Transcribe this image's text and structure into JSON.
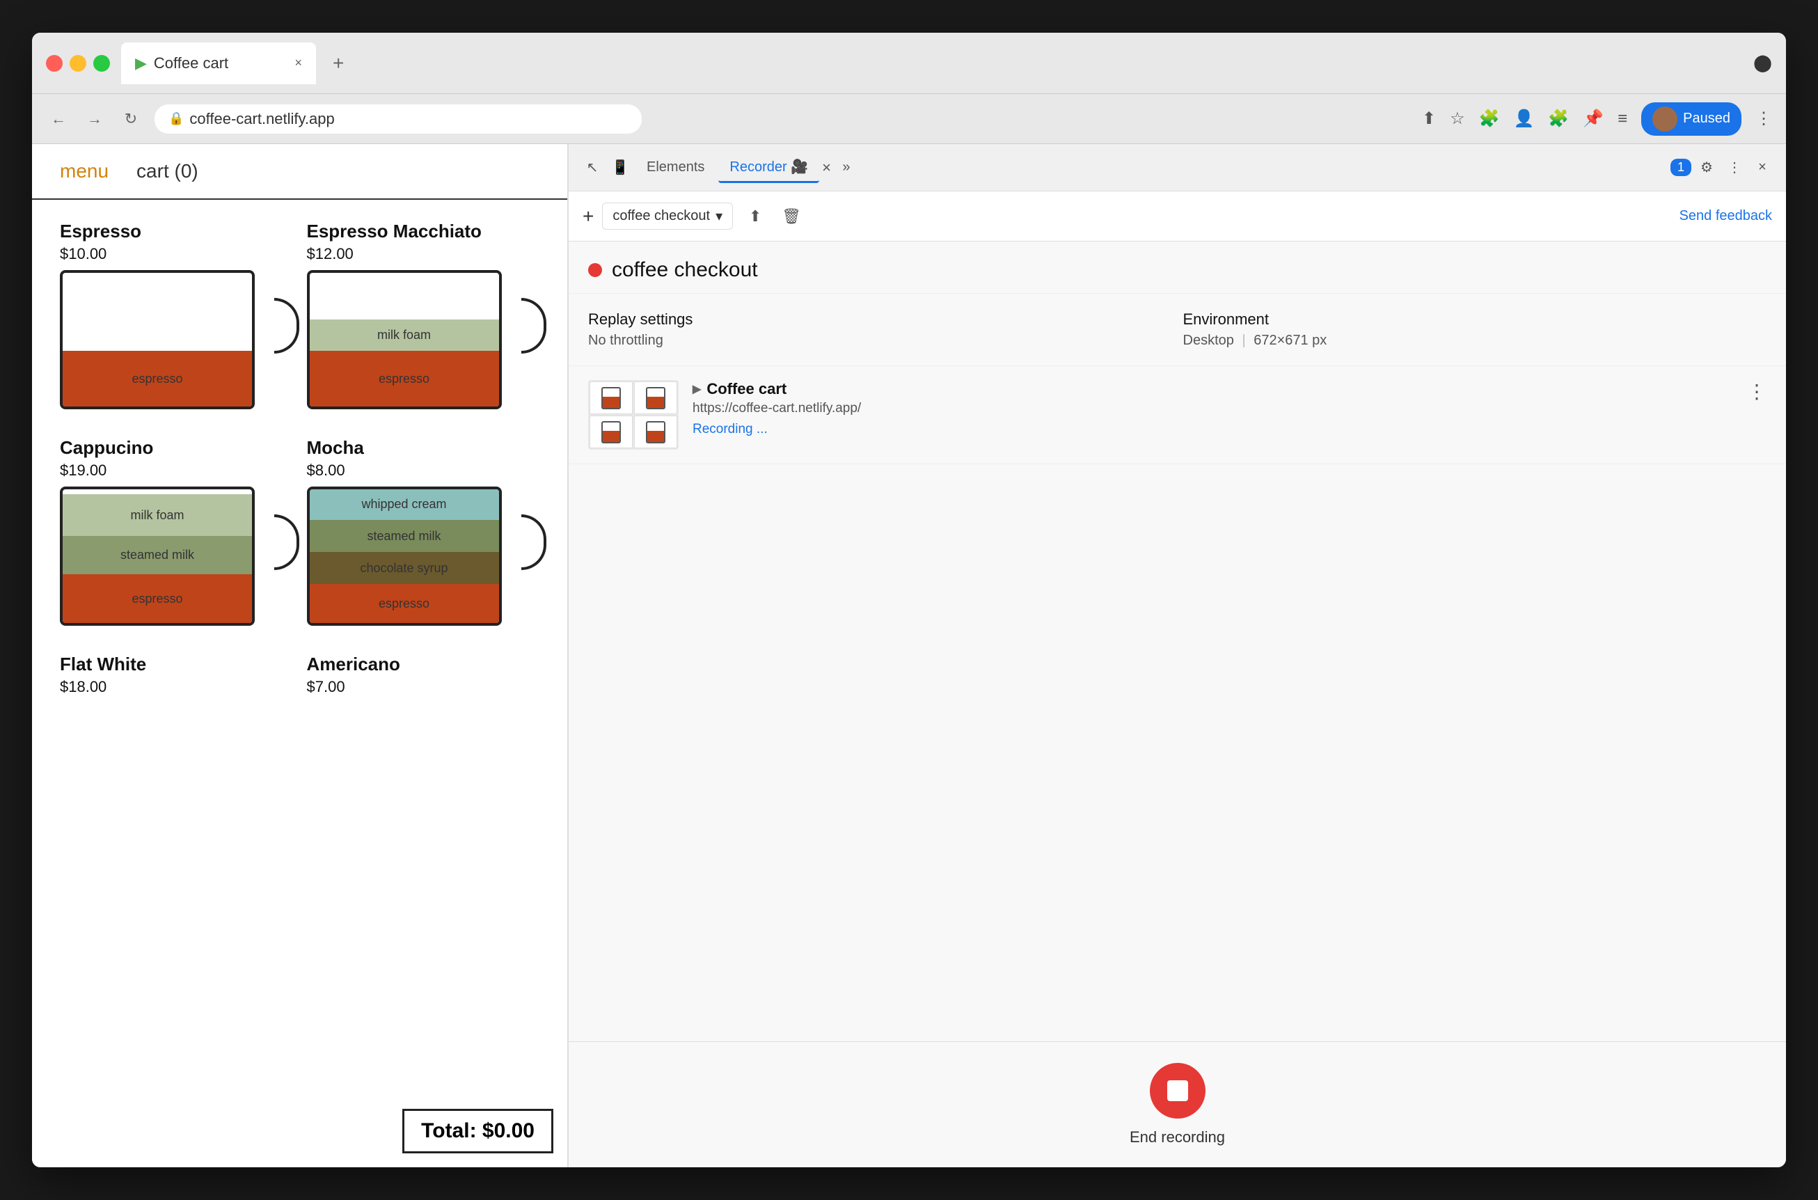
{
  "browser": {
    "tab_title": "Coffee cart",
    "tab_favicon": "▶",
    "new_tab_icon": "+",
    "address": "coffee-cart.netlify.app",
    "nav_back": "←",
    "nav_forward": "→",
    "nav_reload": "↻",
    "paused_label": "Paused",
    "devtools_circle_icon": "⬤"
  },
  "devtools": {
    "add_icon": "+",
    "recorder_name": "coffee checkout",
    "dropdown_icon": "▾",
    "upload_icon": "⬆",
    "delete_icon": "🗑",
    "feedback_label": "Send feedback",
    "tabs": [
      "Elements",
      "Recorder 🎥 ×"
    ],
    "more_tabs_icon": "»",
    "chat_badge": "1",
    "settings_icon": "⚙",
    "more_icon": "⋮",
    "close_icon": "×",
    "recording_dot_color": "#e53935",
    "recording_title": "coffee checkout",
    "replay_settings_label": "Replay settings",
    "throttling_label": "No throttling",
    "environment_label": "Environment",
    "environment_value": "Desktop",
    "separator": "|",
    "resolution": "672×671 px",
    "coffee_cart_title": "Coffee cart",
    "coffee_cart_url": "https://coffee-cart.netlify.app/",
    "recording_status": "Recording ...",
    "more_options_icon": "⋮",
    "end_recording_label": "End recording",
    "stop_icon_color": "#e53935"
  },
  "website": {
    "nav_menu": "menu",
    "nav_cart": "cart (0)",
    "items": [
      {
        "id": "espresso",
        "name": "Espresso",
        "price": "$10.00",
        "layers": [
          {
            "label": "espresso",
            "class": "layer-espresso",
            "height": 80
          }
        ]
      },
      {
        "id": "espresso-macchiato",
        "name": "Espresso Macchiato",
        "price": "$12.00",
        "layers": [
          {
            "label": "milk foam",
            "class": "layer-milk-foam-light",
            "height": 45
          },
          {
            "label": "espresso",
            "class": "layer-espresso",
            "height": 80
          }
        ]
      },
      {
        "id": "cappucino",
        "name": "Cappucino",
        "price": "$19.00",
        "layers": [
          {
            "label": "milk foam",
            "class": "layer-milk-foam-cap",
            "height": 70
          },
          {
            "label": "steamed milk",
            "class": "layer-steamed-milk-cap",
            "height": 55
          },
          {
            "label": "espresso",
            "class": "layer-espresso-cap",
            "height": 70
          }
        ]
      },
      {
        "id": "mocha",
        "name": "Mocha",
        "price": "$8.00",
        "layers": [
          {
            "label": "whipped cream",
            "class": "layer-whipped-cream",
            "height": 50
          },
          {
            "label": "steamed milk",
            "class": "layer-steamed-milk",
            "height": 46
          },
          {
            "label": "chocolate syrup",
            "class": "layer-chocolate",
            "height": 48
          },
          {
            "label": "espresso",
            "class": "layer-espresso-mocha",
            "height": 58
          }
        ]
      },
      {
        "id": "flat-white",
        "name": "Flat White",
        "price": "$18.00",
        "layers": []
      },
      {
        "id": "americano",
        "name": "Americano",
        "price": "$7.00",
        "layers": []
      }
    ],
    "total_label": "Total: $0.00"
  }
}
